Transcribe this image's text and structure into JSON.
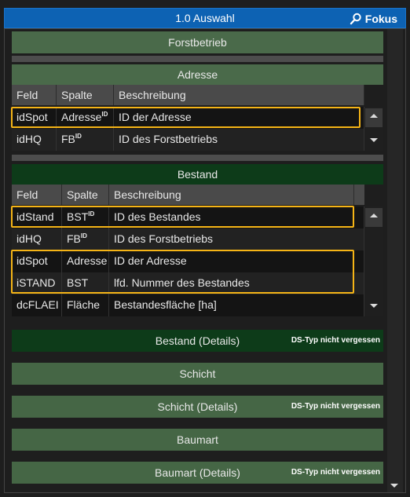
{
  "window": {
    "title": "1.0 Auswahl",
    "focus_label": "Fokus"
  },
  "sections": {
    "forstbetrieb": "Forstbetrieb",
    "adresse": "Adresse",
    "bestand": "Bestand",
    "bestand_details": "Bestand (Details)",
    "schicht": "Schicht",
    "schicht_details": "Schicht (Details)",
    "baumart": "Baumart",
    "baumart_details": "Baumart (Details)",
    "ds_note": "DS-Typ nicht vergessen"
  },
  "grid_headers": {
    "feld": "Feld",
    "spalte": "Spalte",
    "beschreibung": "Beschreibung"
  },
  "adresse_rows": [
    {
      "feld": "idSpot",
      "spalte": "Adresse",
      "id_mark": "ID",
      "beschreibung": "ID der Adresse"
    },
    {
      "feld": "idHQ",
      "spalte": "FB",
      "id_mark": "ID",
      "beschreibung": "ID des Forstbetriebs"
    }
  ],
  "bestand_rows": [
    {
      "feld": "idStand",
      "spalte": "BST",
      "id_mark": "ID",
      "beschreibung": "ID des Bestandes"
    },
    {
      "feld": "idHQ",
      "spalte": "FB",
      "id_mark": "ID",
      "beschreibung": "ID des Forstbetriebs"
    },
    {
      "feld": "idSpot",
      "spalte": "Adresse",
      "id_mark": "",
      "beschreibung": "ID der Adresse"
    },
    {
      "feld": "iSTAND",
      "spalte": "BST",
      "id_mark": "",
      "beschreibung": "lfd. Nummer des Bestandes"
    },
    {
      "feld": "dcFLAEI",
      "spalte": "Fläche",
      "id_mark": "",
      "beschreibung": "Bestandesfläche [ha]"
    }
  ],
  "colors": {
    "titlebar": "#0d62b3",
    "highlight": "#f5b416",
    "section_light": "#4a6a4a",
    "section_dark": "#0d3b19"
  },
  "icons": {
    "focus": "search-icon",
    "scroll_up": "arrow-up-icon",
    "scroll_down": "arrow-down-icon"
  }
}
